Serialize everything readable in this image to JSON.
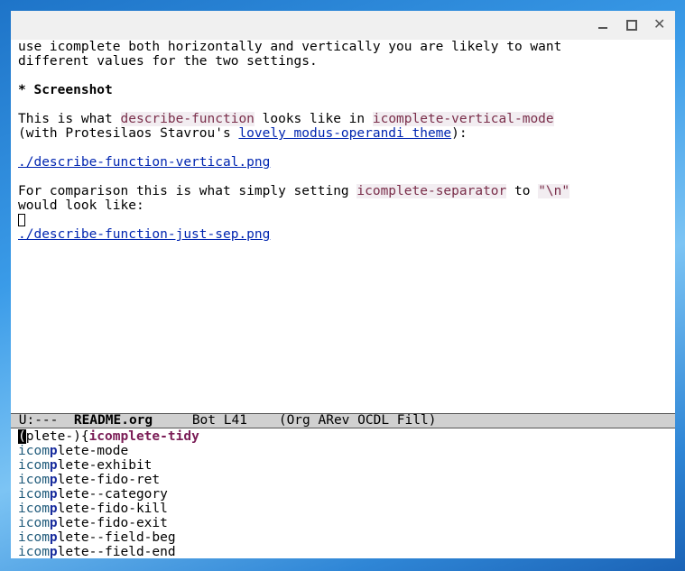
{
  "window": {
    "controls": [
      "minimize",
      "maximize",
      "close"
    ],
    "close_glyph": "✕"
  },
  "buffer": {
    "lines": {
      "l1": "use icomplete both horizontally and vertically you are likely to want",
      "l2": "different values for the two settings.",
      "heading": "* Screenshot",
      "p1_a": "This is what ",
      "p1_code1": "describe-function",
      "p1_b": " looks like in ",
      "p1_code2": "icomplete-vertical-mode",
      "p2_a": "(with Protesilaos Stavrou's ",
      "p2_link": "lovely modus-operandi theme",
      "p2_b": "):",
      "link1": "./describe-function-vertical.png",
      "p3_a": "For comparison this is what simply setting ",
      "p3_code1": "icomplete-separator",
      "p3_b": " to ",
      "p3_code2": "\"\\n\"",
      "p4": "would look like:",
      "link2": "./describe-function-just-sep.png"
    }
  },
  "modeline": {
    "status": " U:--- ",
    "buffer_name": "README.org",
    "position": "Bot L41",
    "modes": "(Org ARev OCDL Fill)"
  },
  "minibuffer": {
    "input_cursor": "(",
    "input_rest": "plete-)",
    "open_brace": "{",
    "selected": "icomplete-tidy",
    "candidates": [
      {
        "prefix": "icom",
        "match": "p",
        "rest": "lete-mode"
      },
      {
        "prefix": "icom",
        "match": "p",
        "rest": "lete-exhibit"
      },
      {
        "prefix": "icom",
        "match": "p",
        "rest": "lete-fido-ret"
      },
      {
        "prefix": "icom",
        "match": "p",
        "rest": "lete--category"
      },
      {
        "prefix": "icom",
        "match": "p",
        "rest": "lete-fido-kill"
      },
      {
        "prefix": "icom",
        "match": "p",
        "rest": "lete-fido-exit"
      },
      {
        "prefix": "icom",
        "match": "p",
        "rest": "lete--field-beg"
      },
      {
        "prefix": "icom",
        "match": "p",
        "rest": "lete--field-end"
      }
    ]
  }
}
